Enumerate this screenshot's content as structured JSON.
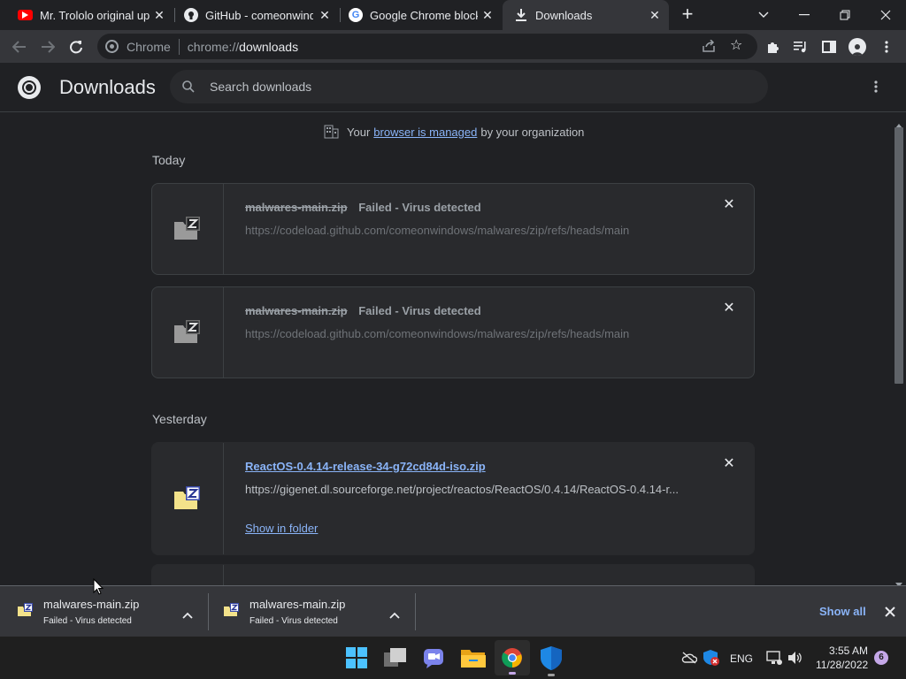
{
  "tabs": [
    {
      "title": "Mr. Trololo original upl",
      "icon": "youtube-icon"
    },
    {
      "title": "GitHub - comeonwindo",
      "icon": "github-icon"
    },
    {
      "title": "Google Chrome blocks",
      "icon": "google-icon"
    },
    {
      "title": "Downloads",
      "icon": "download-icon",
      "active": true
    }
  ],
  "omnibox": {
    "site_label": "Chrome",
    "url_prefix": "chrome://",
    "url_page": "downloads"
  },
  "header": {
    "title": "Downloads",
    "search_placeholder": "Search downloads"
  },
  "managed": {
    "prefix": "Your",
    "link": "browser is managed",
    "suffix": "by your organization"
  },
  "sections": {
    "today": "Today",
    "yesterday": "Yesterday"
  },
  "items": [
    {
      "filename": "malwares-main.zip",
      "status": "Failed - Virus detected",
      "url": "https://codeload.github.com/comeonwindows/malwares/zip/refs/heads/main"
    },
    {
      "filename": "malwares-main.zip",
      "status": "Failed - Virus detected",
      "url": "https://codeload.github.com/comeonwindows/malwares/zip/refs/heads/main"
    },
    {
      "filename": "ReactOS-0.4.14-release-34-g72cd84d-iso.zip",
      "url": "https://gigenet.dl.sourceforge.net/project/reactos/ReactOS/0.4.14/ReactOS-0.4.14-r...",
      "action": "Show in folder"
    }
  ],
  "shelf": {
    "items": [
      {
        "filename": "malwares-main.zip",
        "status": "Failed - Virus detected"
      },
      {
        "filename": "malwares-main.zip",
        "status": "Failed - Virus detected"
      }
    ],
    "show_all": "Show all"
  },
  "taskbar": {
    "lang": "ENG",
    "time": "3:55 AM",
    "date": "11/28/2022",
    "notifications": "6"
  },
  "colors": {
    "accent_link": "#8ab4f8",
    "bg": "#202124",
    "surface": "#292a2d",
    "toolbar": "#35363a"
  }
}
